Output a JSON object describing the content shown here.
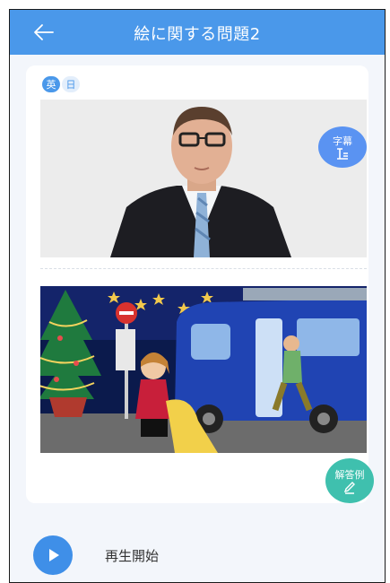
{
  "header": {
    "title": "絵に関する問題2",
    "back_icon": "arrow-left-icon",
    "color": "#4a98ea"
  },
  "lang_toggle": {
    "en": "英",
    "ja": "日"
  },
  "video": {
    "subtitle_label": "字幕",
    "subtitle_icon": "subtitle-lines-icon"
  },
  "illustration": {
    "answer_label": "解答例",
    "answer_icon": "pencil-icon"
  },
  "player": {
    "play_label": "再生開始",
    "play_icon": "play-icon"
  },
  "colors": {
    "accent": "#4a98ea",
    "answer": "#3fc0ae",
    "background": "#f3f6fb"
  }
}
